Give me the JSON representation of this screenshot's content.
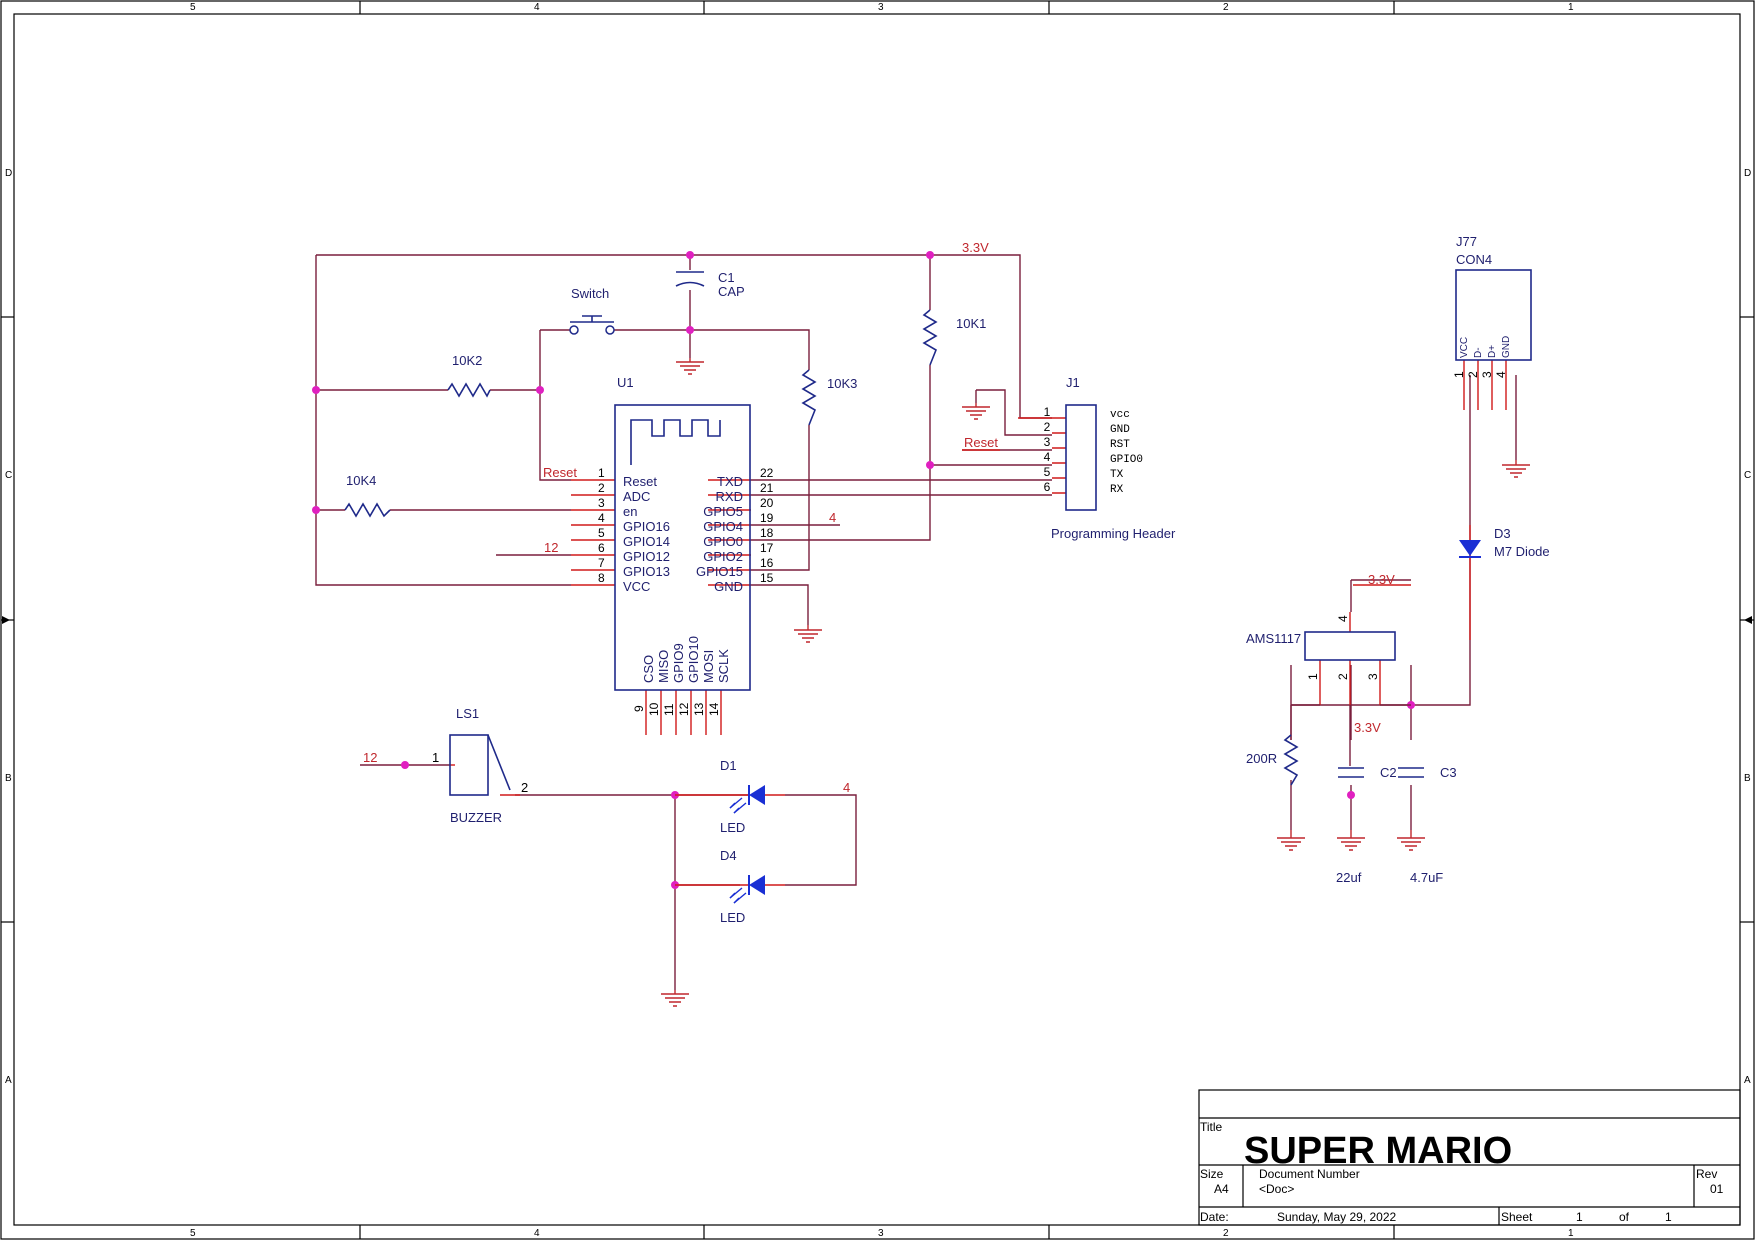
{
  "border": {
    "columns": [
      "5",
      "4",
      "3",
      "2",
      "1"
    ],
    "rows": [
      "D",
      "C",
      "B",
      "A"
    ]
  },
  "nets": {
    "vcc_top": "3.3V",
    "reset": "Reset",
    "reset_j1": "Reset",
    "net12_u1": "12",
    "net4_u1": "4",
    "net12_ls1": "12",
    "net4_d1": "4",
    "reg_in": "3.3V",
    "reg_out": "3.3V"
  },
  "components": {
    "c1": {
      "ref": "C1",
      "value": "CAP"
    },
    "switch": {
      "label": "Switch"
    },
    "r10k1": {
      "ref": "10K1"
    },
    "r10k2": {
      "ref": "10K2"
    },
    "r10k3": {
      "ref": "10K3"
    },
    "r10k4": {
      "ref": "10K4"
    },
    "u1": {
      "ref": "U1",
      "left_pins": [
        {
          "num": "1",
          "name": "Reset"
        },
        {
          "num": "2",
          "name": "ADC"
        },
        {
          "num": "3",
          "name": "en"
        },
        {
          "num": "4",
          "name": "GPIO16"
        },
        {
          "num": "5",
          "name": "GPIO14"
        },
        {
          "num": "6",
          "name": "GPIO12"
        },
        {
          "num": "7",
          "name": "GPIO13"
        },
        {
          "num": "8",
          "name": "VCC"
        }
      ],
      "right_pins": [
        {
          "num": "22",
          "name": "TXD"
        },
        {
          "num": "21",
          "name": "RXD"
        },
        {
          "num": "20",
          "name": "GPIO5"
        },
        {
          "num": "19",
          "name": "GPIO4"
        },
        {
          "num": "18",
          "name": "GPIO0"
        },
        {
          "num": "17",
          "name": "GPIO2"
        },
        {
          "num": "16",
          "name": "GPIO15"
        },
        {
          "num": "15",
          "name": "GND"
        }
      ],
      "bottom_pins": [
        {
          "num": "9",
          "name": "CSO"
        },
        {
          "num": "10",
          "name": "MISO"
        },
        {
          "num": "11",
          "name": "GPIO9"
        },
        {
          "num": "12",
          "name": "GPIO10"
        },
        {
          "num": "13",
          "name": "MOSI"
        },
        {
          "num": "14",
          "name": "SCLK"
        }
      ]
    },
    "j1": {
      "ref": "J1",
      "caption": "Programming Header",
      "pins": [
        {
          "num": "1",
          "name": "vcc"
        },
        {
          "num": "2",
          "name": "GND"
        },
        {
          "num": "3",
          "name": "RST"
        },
        {
          "num": "4",
          "name": "GPIO0"
        },
        {
          "num": "5",
          "name": "TX"
        },
        {
          "num": "6",
          "name": "RX"
        }
      ]
    },
    "j77": {
      "ref": "J77",
      "value": "CON4",
      "pins": [
        {
          "num": "1",
          "name": "VCC"
        },
        {
          "num": "2",
          "name": "D-"
        },
        {
          "num": "3",
          "name": "D+"
        },
        {
          "num": "4",
          "name": "GND"
        }
      ]
    },
    "d3": {
      "ref": "D3",
      "value": "M7 Diode"
    },
    "ams": {
      "ref": "AMS1117",
      "pins": [
        "1",
        "2",
        "3",
        "4"
      ]
    },
    "r200": {
      "ref": "200R"
    },
    "c2": {
      "ref": "C2",
      "value": "22uf"
    },
    "c3": {
      "ref": "C3",
      "value": "4.7uF"
    },
    "ls1": {
      "ref": "LS1",
      "value": "BUZZER",
      "pin1": "1",
      "pin2": "2"
    },
    "d1": {
      "ref": "D1",
      "value": "LED"
    },
    "d4": {
      "ref": "D4",
      "value": "LED"
    }
  },
  "title_block": {
    "title_label": "Title",
    "title": "SUPER MARIO",
    "size_label": "Size",
    "size": "A4",
    "doc_label": "Document Number",
    "doc": "<Doc>",
    "rev_label": "Rev",
    "rev": "01",
    "date_label": "Date:",
    "date": "Sunday, May 29, 2022",
    "sheet_label": "Sheet",
    "sheet": "1",
    "of_label": "of",
    "sheets": "1"
  }
}
